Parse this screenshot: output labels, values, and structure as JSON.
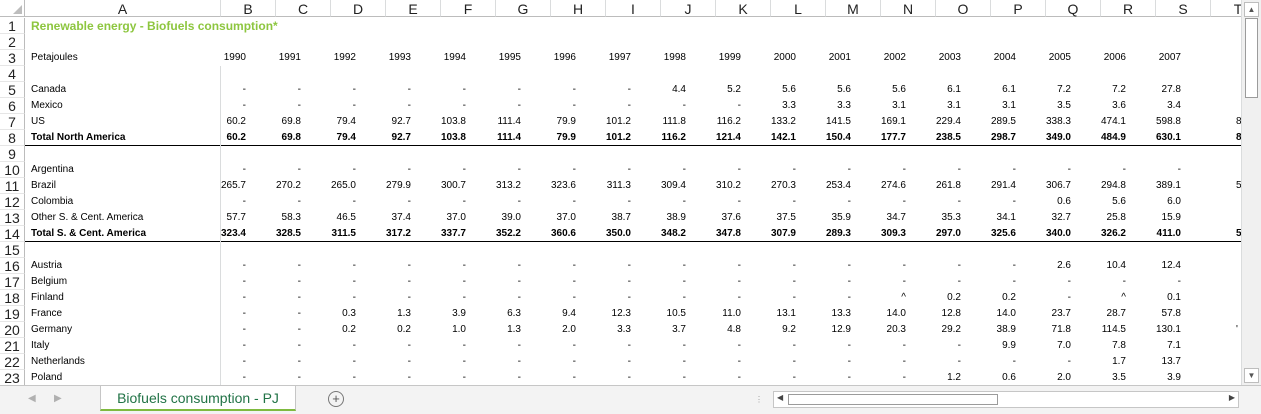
{
  "columns": [
    "A",
    "B",
    "C",
    "D",
    "E",
    "F",
    "G",
    "H",
    "I",
    "J",
    "K",
    "L",
    "M",
    "N",
    "O",
    "P",
    "Q",
    "R",
    "S",
    "T"
  ],
  "title": "Renewable energy -  Biofuels consumption*",
  "unit_label": "Petajoules",
  "years": [
    "1990",
    "1991",
    "1992",
    "1993",
    "1994",
    "1995",
    "1996",
    "1997",
    "1998",
    "1999",
    "2000",
    "2001",
    "2002",
    "2003",
    "2004",
    "2005",
    "2006",
    "2007"
  ],
  "rows": [
    {
      "n": "1"
    },
    {
      "n": "2"
    },
    {
      "n": "3"
    },
    {
      "n": "4"
    },
    {
      "n": "5",
      "label": "Canada",
      "v": [
        "-",
        "-",
        "-",
        "-",
        "-",
        "-",
        "-",
        "-",
        "4.4",
        "5.2",
        "5.6",
        "5.6",
        "5.6",
        "6.1",
        "6.1",
        "7.2",
        "7.2",
        "27.8"
      ]
    },
    {
      "n": "6",
      "label": "Mexico",
      "v": [
        "-",
        "-",
        "-",
        "-",
        "-",
        "-",
        "-",
        "-",
        "-",
        "-",
        "3.3",
        "3.3",
        "3.1",
        "3.1",
        "3.1",
        "3.5",
        "3.6",
        "3.4"
      ]
    },
    {
      "n": "7",
      "label": "US",
      "v": [
        "60.2",
        "69.8",
        "79.4",
        "92.7",
        "103.8",
        "111.4",
        "79.9",
        "101.2",
        "111.8",
        "116.2",
        "133.2",
        "141.5",
        "169.1",
        "229.4",
        "289.5",
        "338.3",
        "474.1",
        "598.8"
      ],
      "t": "8"
    },
    {
      "n": "8",
      "label": "Total North America",
      "bold": true,
      "v": [
        "60.2",
        "69.8",
        "79.4",
        "92.7",
        "103.8",
        "111.4",
        "79.9",
        "101.2",
        "116.2",
        "121.4",
        "142.1",
        "150.4",
        "177.7",
        "238.5",
        "298.7",
        "349.0",
        "484.9",
        "630.1"
      ],
      "t": "8"
    },
    {
      "n": "9"
    },
    {
      "n": "10",
      "label": "Argentina",
      "v": [
        "-",
        "-",
        "-",
        "-",
        "-",
        "-",
        "-",
        "-",
        "-",
        "-",
        "-",
        "-",
        "-",
        "-",
        "-",
        "-",
        "-",
        "-"
      ]
    },
    {
      "n": "11",
      "label": "Brazil",
      "v": [
        "265.7",
        "270.2",
        "265.0",
        "279.9",
        "300.7",
        "313.2",
        "323.6",
        "311.3",
        "309.4",
        "310.2",
        "270.3",
        "253.4",
        "274.6",
        "261.8",
        "291.4",
        "306.7",
        "294.8",
        "389.1"
      ],
      "t": "5"
    },
    {
      "n": "12",
      "label": "Colombia",
      "v": [
        "-",
        "-",
        "-",
        "-",
        "-",
        "-",
        "-",
        "-",
        "-",
        "-",
        "-",
        "-",
        "-",
        "-",
        "-",
        "0.6",
        "5.6",
        "6.0"
      ]
    },
    {
      "n": "13",
      "label": "Other S. & Cent. America",
      "v": [
        "57.7",
        "58.3",
        "46.5",
        "37.4",
        "37.0",
        "39.0",
        "37.0",
        "38.7",
        "38.9",
        "37.6",
        "37.5",
        "35.9",
        "34.7",
        "35.3",
        "34.1",
        "32.7",
        "25.8",
        "15.9"
      ]
    },
    {
      "n": "14",
      "label": "Total S. & Cent. America",
      "bold": true,
      "v": [
        "323.4",
        "328.5",
        "311.5",
        "317.2",
        "337.7",
        "352.2",
        "360.6",
        "350.0",
        "348.2",
        "347.8",
        "307.9",
        "289.3",
        "309.3",
        "297.0",
        "325.6",
        "340.0",
        "326.2",
        "411.0"
      ],
      "t": "5"
    },
    {
      "n": "15"
    },
    {
      "n": "16",
      "label": "Austria",
      "v": [
        "-",
        "-",
        "-",
        "-",
        "-",
        "-",
        "-",
        "-",
        "-",
        "-",
        "-",
        "-",
        "-",
        "-",
        "-",
        "2.6",
        "10.4",
        "12.4"
      ]
    },
    {
      "n": "17",
      "label": "Belgium",
      "v": [
        "-",
        "-",
        "-",
        "-",
        "-",
        "-",
        "-",
        "-",
        "-",
        "-",
        "-",
        "-",
        "-",
        "-",
        "-",
        "-",
        "-",
        "-"
      ]
    },
    {
      "n": "18",
      "label": "Finland",
      "v": [
        "-",
        "-",
        "-",
        "-",
        "-",
        "-",
        "-",
        "-",
        "-",
        "-",
        "-",
        "-",
        "^",
        "0.2",
        "0.2",
        "-",
        "^",
        "0.1"
      ]
    },
    {
      "n": "19",
      "label": "France",
      "v": [
        "-",
        "-",
        "0.3",
        "1.3",
        "3.9",
        "6.3",
        "9.4",
        "12.3",
        "10.5",
        "11.0",
        "13.1",
        "13.3",
        "14.0",
        "12.8",
        "14.0",
        "23.7",
        "28.7",
        "57.8"
      ]
    },
    {
      "n": "20",
      "label": "Germany",
      "v": [
        "-",
        "-",
        "0.2",
        "0.2",
        "1.0",
        "1.3",
        "2.0",
        "3.3",
        "3.7",
        "4.8",
        "9.2",
        "12.9",
        "20.3",
        "29.2",
        "38.9",
        "71.8",
        "114.5",
        "130.1"
      ],
      "t": "'"
    },
    {
      "n": "21",
      "label": "Italy",
      "v": [
        "-",
        "-",
        "-",
        "-",
        "-",
        "-",
        "-",
        "-",
        "-",
        "-",
        "-",
        "-",
        "-",
        "-",
        "9.9",
        "7.0",
        "7.8",
        "7.1"
      ]
    },
    {
      "n": "22",
      "label": "Netherlands",
      "v": [
        "-",
        "-",
        "-",
        "-",
        "-",
        "-",
        "-",
        "-",
        "-",
        "-",
        "-",
        "-",
        "-",
        "-",
        "-",
        "-",
        "1.7",
        "13.7"
      ]
    },
    {
      "n": "23",
      "label": "Poland",
      "v": [
        "-",
        "-",
        "-",
        "-",
        "-",
        "-",
        "-",
        "-",
        "-",
        "-",
        "-",
        "-",
        "-",
        "1.2",
        "0.6",
        "2.0",
        "3.5",
        "3.9"
      ]
    }
  ],
  "sheet_tab": "Biofuels consumption - PJ",
  "add_sheet_symbol": "+"
}
